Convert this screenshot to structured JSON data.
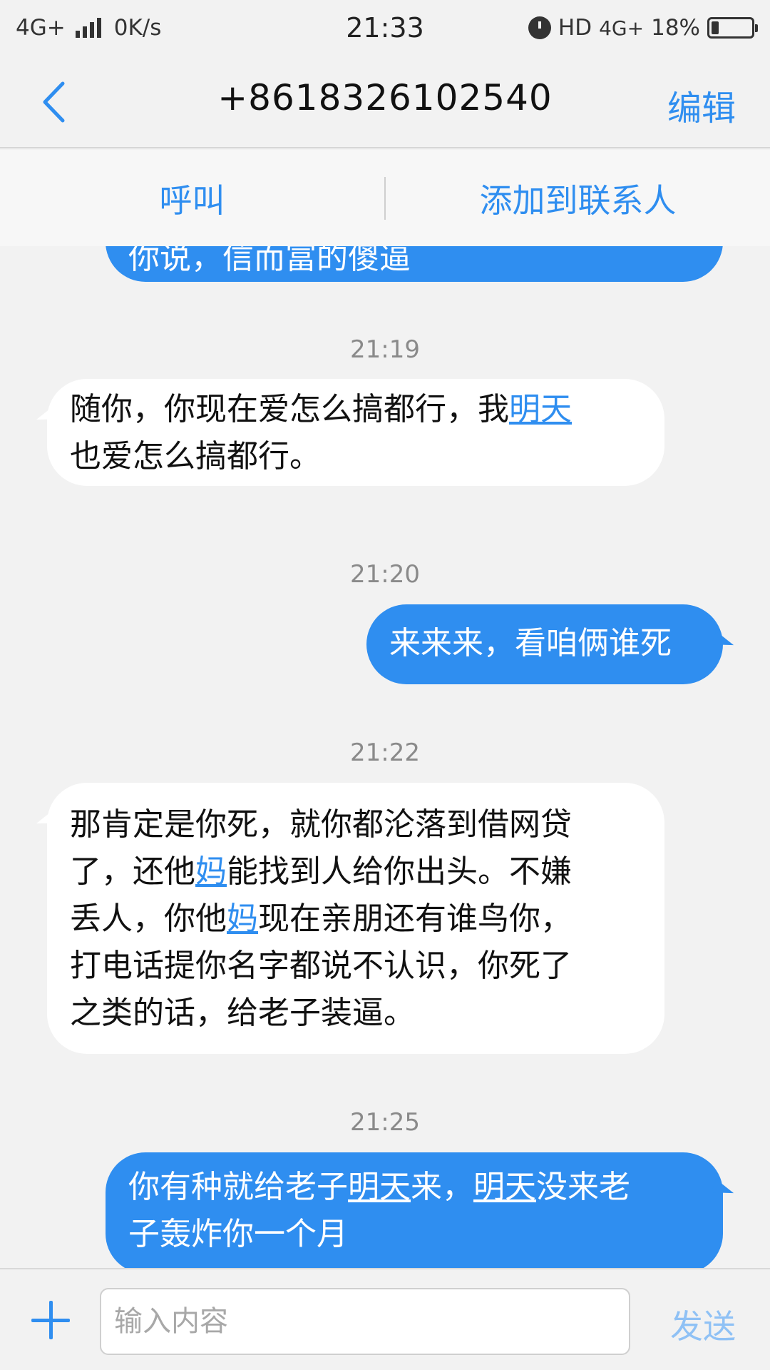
{
  "status_bar": {
    "network": "4G+",
    "speed": "0K/s",
    "time": "21:33",
    "hd": "HD",
    "network2": "4G+",
    "battery": "18%",
    "battery_level": 0.18
  },
  "header": {
    "back_icon": "chevron-left-icon",
    "title": "+8618326102540",
    "edit_label": "编辑"
  },
  "actions": {
    "call_label": "呼叫",
    "add_contact_label": "添加到联系人"
  },
  "conversation": {
    "top_partial_text": "你说，信而富的傻逼",
    "timestamps": [
      "21:19",
      "21:20",
      "21:22",
      "21:25"
    ],
    "msg1": {
      "line1_a": "随你，你现在爱怎么搞都行，我",
      "line1_link": "明天",
      "line2": "也爱怎么搞都行。"
    },
    "msg2": {
      "line1": "来来来，看咱俩谁死"
    },
    "msg3": {
      "line1": "那肯定是你死，就你都沦落到借网贷",
      "line2_a": "了，还他",
      "line2_link": "妈",
      "line2_b": "能找到人给你出头。不嫌",
      "line3_a": "丢人，你他",
      "line3_link": "妈",
      "line3_b": "现在亲朋还有谁鸟你，",
      "line4": "打电话提你名字都说不认识，你死了",
      "line5": "之类的话，给老子装逼。"
    },
    "msg4": {
      "line1_a": "你有种就给老子",
      "line1_link1": "明天",
      "line1_b": "来，",
      "line1_link2": "明天",
      "line1_c": "没来老",
      "line2": "子轰炸你一个月"
    }
  },
  "input_bar": {
    "add_icon": "plus-icon",
    "placeholder": "输入内容",
    "send_label": "发送"
  },
  "colors": {
    "accent": "#2f8ef0",
    "outgoing_bubble": "#2f8ef0",
    "incoming_bubble": "#ffffff",
    "background": "#f2f2f2"
  }
}
